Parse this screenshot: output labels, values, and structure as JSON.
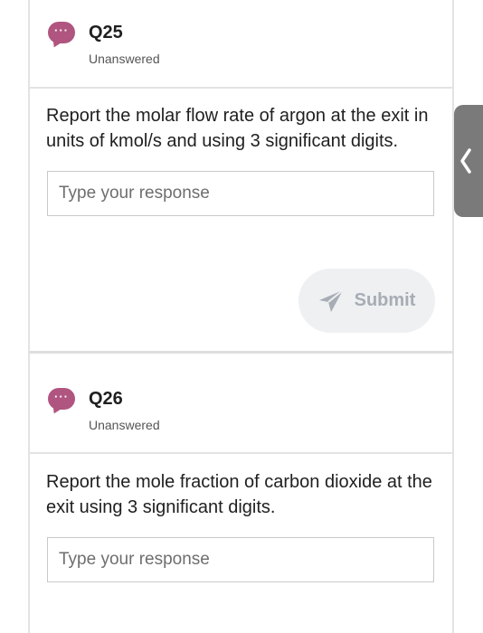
{
  "questions": [
    {
      "number": "Q25",
      "status": "Unanswered",
      "prompt": "Report the molar flow rate of argon at the exit in units of kmol/s and using 3 significant digits.",
      "input_placeholder": "Type your response",
      "submit_label": "Submit"
    },
    {
      "number": "Q26",
      "status": "Unanswered",
      "prompt": "Report the mole fraction of carbon dioxide at the exit using 3 significant digits.",
      "input_placeholder": "Type your response"
    }
  ],
  "icons": {
    "question": "chat-bubble-icon",
    "submit": "send-icon",
    "side_tab": "chevron-left-icon"
  },
  "colors": {
    "chat_icon": "#b0557f",
    "submit_bg": "#eef0f2",
    "submit_text": "#a7adb5",
    "side_tab": "#7a7a7a"
  }
}
